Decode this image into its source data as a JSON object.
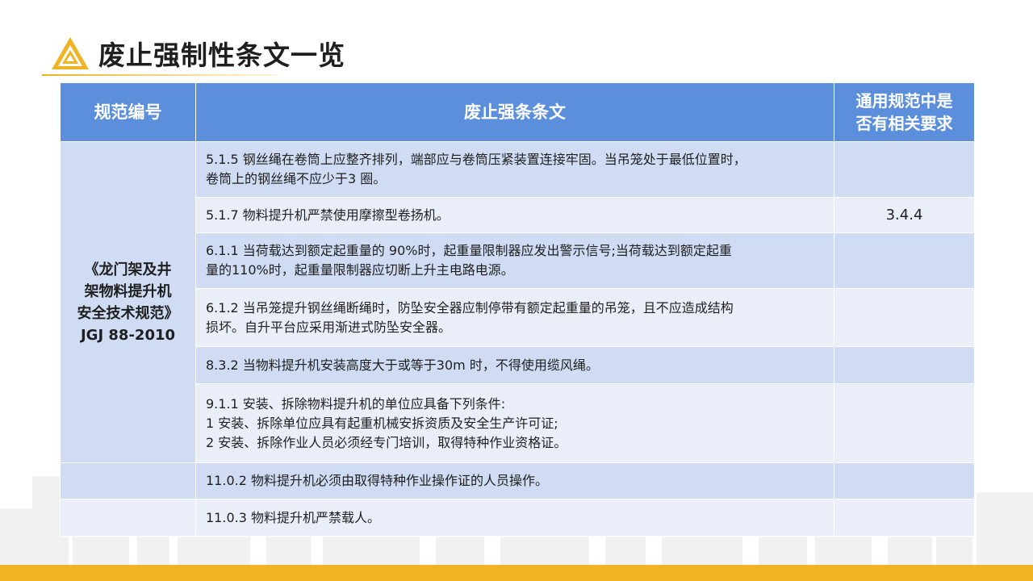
{
  "page": {
    "title": "废止强制性条文一览",
    "logo_icon": "yellow-triangle-logo-icon",
    "accent_color": "#f0b323",
    "header_color": "#5b8fdc"
  },
  "table": {
    "headers": {
      "code": "规范编号",
      "clause": "废止强条条文",
      "general_line1": "通用规范中是",
      "general_line2": "否有相关要求"
    },
    "spec_name_lines": [
      "《龙门架及井",
      "架物料提升机",
      "安全技术规范》",
      "JGJ 88-2010"
    ],
    "rows": [
      {
        "lines": [
          "5.1.5 钢丝绳在卷筒上应整齐排列，端部应与卷筒压紧装置连接牢固。当吊笼处于最低位置时，",
          "卷筒上的钢丝绳不应少于3 圈。"
        ],
        "ref": ""
      },
      {
        "lines": [
          "5.1.7 物料提升机严禁使用摩擦型卷扬机。"
        ],
        "ref": "3.4.4"
      },
      {
        "lines": [
          "6.1.1 当荷载达到额定起重量的 90%时，起重量限制器应发出警示信号;当荷载达到额定起重",
          "量的110%时，起重量限制器应切断上升主电路电源。"
        ],
        "ref": ""
      },
      {
        "lines": [
          "6.1.2 当吊笼提升钢丝绳断绳时，防坠安全器应制停带有额定起重量的吊笼，且不应造成结构",
          "损坏。自升平台应采用渐进式防坠安全器。"
        ],
        "ref": ""
      },
      {
        "lines": [
          "8.3.2 当物料提升机安装高度大于或等于30m 时，不得使用缆风绳。"
        ],
        "ref": ""
      },
      {
        "lines": [
          "9.1.1 安装、拆除物料提升机的单位应具备下列条件:",
          "1 安装、拆除单位应具有起重机械安拆资质及安全生产许可证;",
          "2 安装、拆除作业人员必须经专门培训，取得特种作业资格证。"
        ],
        "ref": ""
      },
      {
        "lines": [
          "11.0.2 物料提升机必须由取得特种作业操作证的人员操作。"
        ],
        "ref": ""
      },
      {
        "lines": [
          "11.0.3 物料提升机严禁载人。"
        ],
        "ref": ""
      }
    ]
  }
}
